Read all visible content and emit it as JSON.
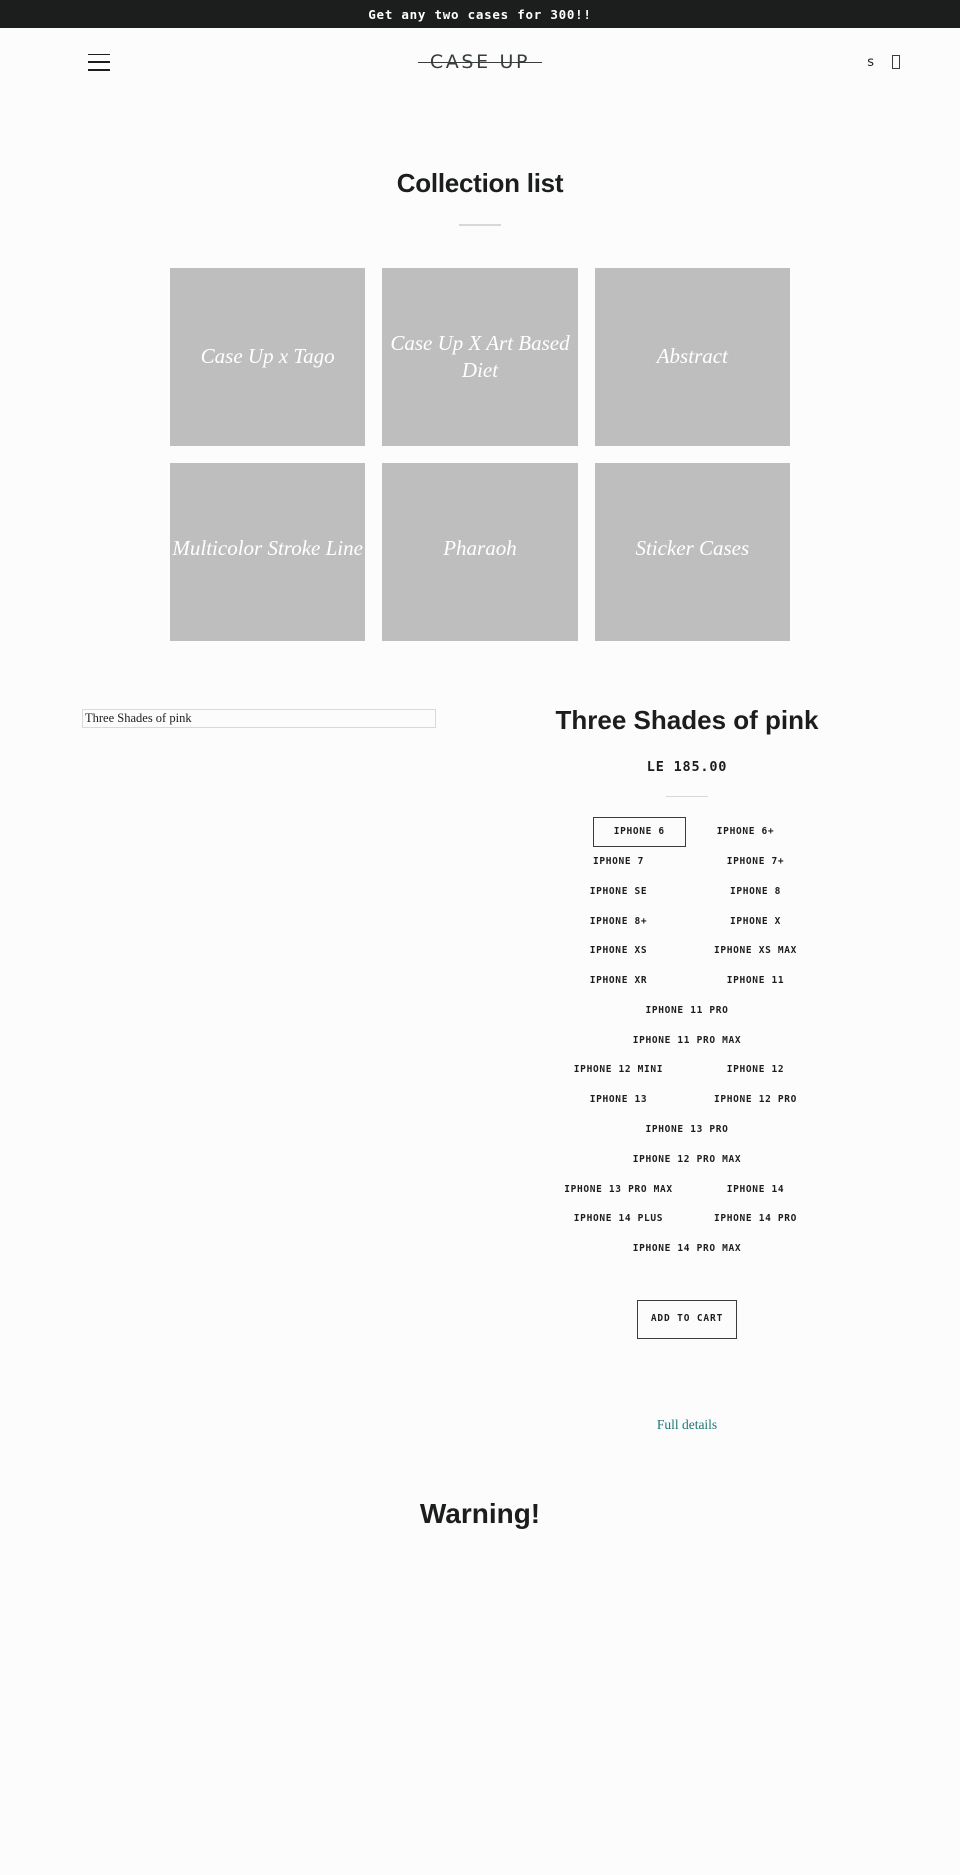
{
  "announcement": {
    "text": "Get any two cases for 300!!"
  },
  "header": {
    "menu_icon": "hamburger-icon",
    "logo": "CASE UP",
    "search_icon": "search-icon",
    "cart_icon": "cart-icon",
    "search_glyph": "s"
  },
  "collection_section": {
    "title": "Collection list",
    "tiles": [
      {
        "label": "Case Up x Tago"
      },
      {
        "label": "Case Up X Art Based Diet"
      },
      {
        "label": "Abstract"
      },
      {
        "label": "Multicolor Stroke Line"
      },
      {
        "label": "Pharaoh"
      },
      {
        "label": "Sticker Cases"
      }
    ]
  },
  "featured_product": {
    "image_alt": "Three Shades of pink",
    "title": "Three Shades of pink",
    "price": "LE 185.00",
    "variants": [
      {
        "label": "IPHONE 6",
        "selected": true,
        "span": "half"
      },
      {
        "label": "IPHONE 6+",
        "selected": false,
        "span": "half"
      },
      {
        "label": "IPHONE 7",
        "selected": false,
        "span": "half"
      },
      {
        "label": "IPHONE 7+",
        "selected": false,
        "span": "half"
      },
      {
        "label": "IPHONE SE",
        "selected": false,
        "span": "half"
      },
      {
        "label": "IPHONE 8",
        "selected": false,
        "span": "half"
      },
      {
        "label": "IPHONE 8+",
        "selected": false,
        "span": "half"
      },
      {
        "label": "IPHONE X",
        "selected": false,
        "span": "half"
      },
      {
        "label": "IPHONE XS",
        "selected": false,
        "span": "half"
      },
      {
        "label": "IPHONE XS MAX",
        "selected": false,
        "span": "half"
      },
      {
        "label": "IPHONE XR",
        "selected": false,
        "span": "half"
      },
      {
        "label": "IPHONE 11",
        "selected": false,
        "span": "half"
      },
      {
        "label": "IPHONE 11 PRO",
        "selected": false,
        "span": "full"
      },
      {
        "label": "IPHONE 11 PRO MAX",
        "selected": false,
        "span": "full"
      },
      {
        "label": "IPHONE 12 MINI",
        "selected": false,
        "span": "half"
      },
      {
        "label": "IPHONE 12",
        "selected": false,
        "span": "half"
      },
      {
        "label": "IPHONE 13",
        "selected": false,
        "span": "half"
      },
      {
        "label": "IPHONE 12 PRO",
        "selected": false,
        "span": "half"
      },
      {
        "label": "IPHONE 13 PRO",
        "selected": false,
        "span": "full"
      },
      {
        "label": "IPHONE 12 PRO MAX",
        "selected": false,
        "span": "full"
      },
      {
        "label": "IPHONE 13 PRO MAX",
        "selected": false,
        "span": "half"
      },
      {
        "label": "IPHONE 14",
        "selected": false,
        "span": "half"
      },
      {
        "label": "IPHONE 14 PLUS",
        "selected": false,
        "span": "half"
      },
      {
        "label": "IPHONE 14 PRO",
        "selected": false,
        "span": "half"
      },
      {
        "label": "IPHONE 14 PRO MAX",
        "selected": false,
        "span": "full"
      }
    ],
    "add_to_cart": "ADD TO CART",
    "full_details": "Full details"
  },
  "warning_section": {
    "title": "Warning!"
  },
  "colors": {
    "announcement_bg": "#1c1d1d",
    "page_bg": "#fcfcfc",
    "tile_bg": "#bebebe",
    "link_teal": "#1d7874",
    "text": "#1c1d1d"
  }
}
